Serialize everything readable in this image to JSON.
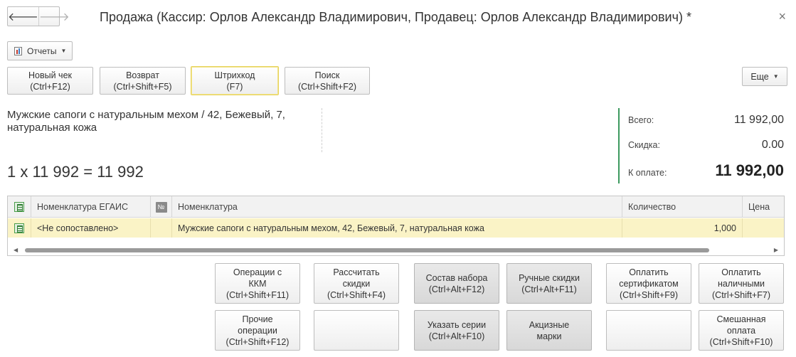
{
  "window": {
    "title": "Продажа (Кассир: Орлов Александр Владимирович, Продавец: Орлов Александр Владимирович) *",
    "close_glyph": "×"
  },
  "nav": {
    "back_glyph": "🡐",
    "forward_glyph": "🡒"
  },
  "toolbar": {
    "reports_label": "Отчеты",
    "more_label": "Еще"
  },
  "top_buttons": [
    {
      "label": "Новый чек",
      "shortcut": "(Ctrl+F12)"
    },
    {
      "label": "Возврат",
      "shortcut": "(Ctrl+Shift+F5)"
    },
    {
      "label": "Штрихкод",
      "shortcut": "(F7)"
    },
    {
      "label": "Поиск",
      "shortcut": "(Ctrl+Shift+F2)"
    }
  ],
  "current_item": {
    "name": "Мужские сапоги с натуральным мехом / 42, Бежевый, 7, натуральная кожа",
    "calculation": "1 x 11 992 = 11 992"
  },
  "totals": {
    "total_label": "Всего:",
    "total_value": "11 992,00",
    "discount_label": "Скидка:",
    "discount_value": "0.00",
    "to_pay_label": "К оплате:",
    "to_pay_value": "11 992,00"
  },
  "table": {
    "headers": [
      "Номенклатура ЕГАИС",
      "№",
      "Номенклатура",
      "Количество",
      "Цена"
    ],
    "rows": [
      {
        "egais": "<Не сопоставлено>",
        "nomenclature": "Мужские сапоги с натуральным мехом, 42, Бежевый, 7, натуральная кожа",
        "quantity": "1,000",
        "price": ""
      }
    ]
  },
  "bottom_buttons": {
    "kkm_ops": [
      "Операции с",
      "ККМ",
      "(Ctrl+Shift+F11)"
    ],
    "calc_discounts": [
      "Рассчитать",
      "скидки",
      "(Ctrl+Shift+F4)"
    ],
    "set_composition": [
      "Состав набора",
      "(Ctrl+Alt+F12)"
    ],
    "manual_discounts": [
      "Ручные скидки",
      "(Ctrl+Alt+F11)"
    ],
    "pay_certificate": [
      "Оплатить",
      "сертификатом",
      "(Ctrl+Shift+F9)"
    ],
    "pay_cash": [
      "Оплатить",
      "наличными",
      "(Ctrl+Shift+F7)"
    ],
    "other_ops": [
      "Прочие",
      "операции",
      "(Ctrl+Shift+F12)"
    ],
    "specify_series": [
      "Указать серии",
      "(Ctrl+Alt+F10)"
    ],
    "excise_marks": [
      "Акцизные",
      "марки"
    ],
    "mixed_payment": [
      "Смешанная",
      "оплата",
      "(Ctrl+Shift+F10)"
    ]
  }
}
